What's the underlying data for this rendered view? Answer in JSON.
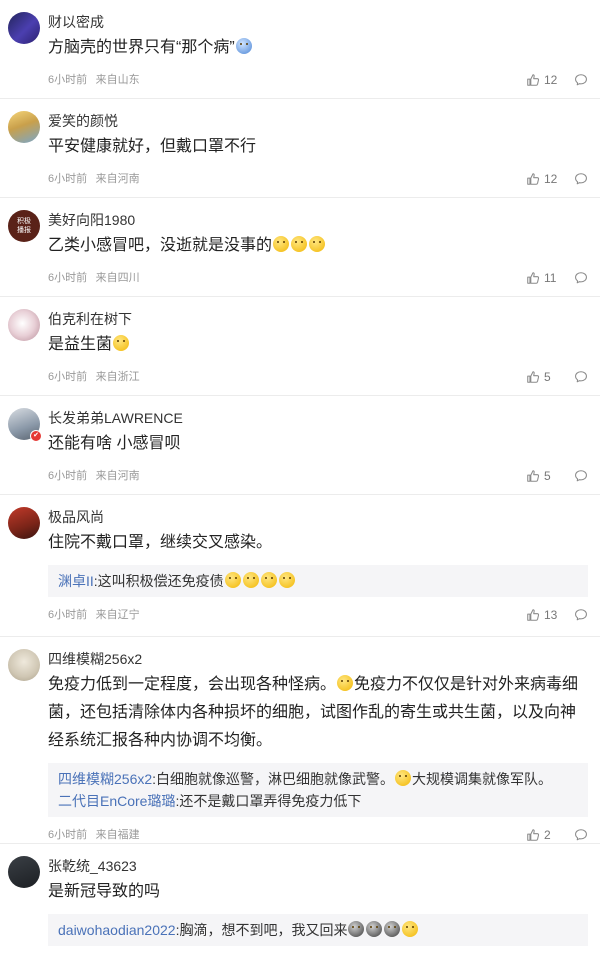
{
  "comments": [
    {
      "user": "财以密成",
      "text": "方脑壳的世界只有“那个病”",
      "emojis": [
        {
          "color": "blue",
          "icon": "bowl-face-emoji"
        }
      ],
      "time": "6小时前",
      "location": "来自山东",
      "likes": "12",
      "avatar": {
        "bg": "linear-gradient(135deg,#22245a,#4b3fb0 55%,#2a1f6e)"
      },
      "replies": []
    },
    {
      "user": "爱笑的颜悦",
      "text": "平安健康就好，但戴口罩不行",
      "emojis": [],
      "time": "6小时前",
      "location": "来自河南",
      "likes": "12",
      "avatar": {
        "bg": "linear-gradient(160deg,#f5d57a,#c9a04b 45%,#7aa6c9)"
      },
      "replies": []
    },
    {
      "user": "美好向阳1980",
      "text": "乙类小感冒吧，没逝就是没事的",
      "emojis": [
        {
          "color": "yellow",
          "icon": "grimace-emoji"
        },
        {
          "color": "yellow",
          "icon": "grimace-emoji"
        },
        {
          "color": "yellow",
          "icon": "grimace-emoji"
        }
      ],
      "time": "6小时前",
      "location": "来自四川",
      "likes": "11",
      "avatar": {
        "bg": "#5a2218",
        "label": "积极\n播报"
      },
      "replies": []
    },
    {
      "user": "伯克利在树下",
      "text": "是益生菌",
      "emojis": [
        {
          "color": "yellow",
          "icon": "angry-face-emoji"
        }
      ],
      "time": "6小时前",
      "location": "来自浙江",
      "likes": "5",
      "avatar": {
        "bg": "radial-gradient(circle at 45% 45%,#ffffff,#e8cfd6 50%,#b58a96)"
      },
      "replies": []
    },
    {
      "user": "长发弟弟LAWRENCE",
      "text": "还能有啥 小感冒呗",
      "emojis": [],
      "time": "6小时前",
      "location": "来自河南",
      "likes": "5",
      "avatar": {
        "bg": "linear-gradient(160deg,#d9dde2,#8a98a8 60%,#5a6470)",
        "badge": true
      },
      "replies": []
    },
    {
      "user": "极品风尚",
      "text": "住院不戴口罩，继续交叉感染。",
      "emojis": [],
      "time": "6小时前",
      "location": "来自辽宁",
      "likes": "13",
      "avatar": {
        "bg": "linear-gradient(160deg,#c23a2a,#7a2418 60%,#3a1410)"
      },
      "replies": [
        {
          "name": "渊卓II",
          "text": ":这叫积极偿还免疫债",
          "emojis": [
            {
              "color": "yellow",
              "icon": "laugh-cry-emoji"
            },
            {
              "color": "yellow",
              "icon": "laugh-cry-emoji"
            },
            {
              "color": "yellow",
              "icon": "laugh-cry-emoji"
            },
            {
              "color": "yellow",
              "icon": "laugh-cry-emoji"
            }
          ]
        }
      ]
    },
    {
      "user": "四维模糊256x2",
      "text": "免疫力低到一定程度，会出现各种怪病。",
      "text2": "免疫力不仅仅是针对外来病毒细菌，还包括清除体内各种损坏的细胞，试图作乱的寄生或共生菌，以及向神经系统汇报各种内协调不均衡。",
      "emojis": [
        {
          "color": "yellow",
          "icon": "tongue-face-emoji"
        }
      ],
      "time": "6小时前",
      "location": "来自福建",
      "likes": "2",
      "avatar": {
        "bg": "radial-gradient(circle at 50% 40%,#efe9dc,#cfc6b3 60%,#a89e88)"
      },
      "replies": [
        {
          "name": "四维模糊256x2",
          "text": ":白细胞就像巡警，淋巴细胞就像武警。",
          "text2": "大规模调集就像军队。",
          "emojis": [
            {
              "color": "yellow",
              "icon": "tongue-face-emoji"
            }
          ]
        },
        {
          "name": "二代目EnCore璐璐",
          "text": ":还不是戴口罩弄得免疫力低下",
          "emojis": []
        }
      ]
    },
    {
      "user": "张乾统_43623",
      "text": "是新冠导致的吗",
      "emojis": [],
      "time": "",
      "location": "",
      "likes": "",
      "avatar": {
        "bg": "linear-gradient(160deg,#3a3f45,#1c1f23)"
      },
      "replies": [
        {
          "name": "daiwohaodian2022",
          "text": ":胸滴，想不到吧，我又回来",
          "emojis": [
            {
              "color": "dark",
              "icon": "skull-emoji"
            },
            {
              "color": "dark",
              "icon": "skull-emoji"
            },
            {
              "color": "dark",
              "icon": "skull-emoji"
            },
            {
              "color": "yellow",
              "icon": "sweat-smile-emoji"
            }
          ]
        }
      ]
    }
  ]
}
